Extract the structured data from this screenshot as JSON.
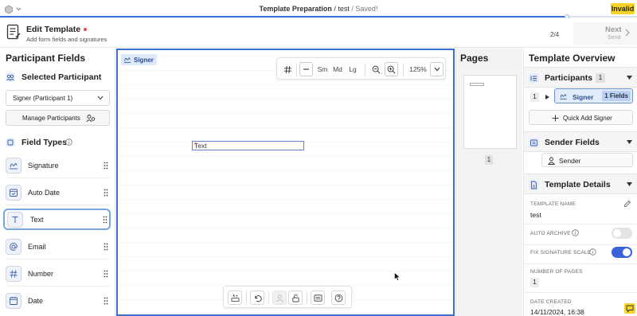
{
  "topbar": {
    "doc_name": "Template Preparation",
    "separator": " / ",
    "template": "test",
    "status": " / Saved!",
    "badge": "Invalid",
    "progress_fraction": 0.89,
    "badge_color": "#f5d328"
  },
  "header": {
    "title": "Edit Template",
    "subtitle": "Add form fields and signatures",
    "step": "2/4",
    "next_label": "Next",
    "next_sub": "Send"
  },
  "left": {
    "title": "Participant Fields",
    "selected_title": "Selected Participant",
    "selected_value": "Signer (Participant 1)",
    "manage_label": "Manage Participants",
    "field_types_title": "Field Types",
    "fields": [
      {
        "label": "Signature",
        "icon": "signature-icon"
      },
      {
        "label": "Auto Date",
        "icon": "calendar-check-icon"
      },
      {
        "label": "Text",
        "icon": "text-icon"
      },
      {
        "label": "Email",
        "icon": "at-icon"
      },
      {
        "label": "Number",
        "icon": "hash-icon"
      },
      {
        "label": "Date",
        "icon": "calendar-icon"
      }
    ],
    "active_field": "Text"
  },
  "canvas": {
    "signer_tag": "Signer",
    "toolbar": {
      "sizes": [
        "Sm",
        "Md",
        "Lg"
      ],
      "zoom": "125%"
    },
    "text_field": {
      "label": "Text",
      "required_mark": "*"
    }
  },
  "pages": {
    "title": "Pages",
    "page_number": "1"
  },
  "overview": {
    "title": "Template Overview",
    "participants_label": "Participants",
    "participants_count": "1",
    "row_number": "1",
    "signer_name": "Signer",
    "signer_fields": "1 Fields",
    "quick_add": "Quick Add Signer",
    "sender_fields_label": "Sender Fields",
    "sender_name": "Sender",
    "details_label": "Template Details",
    "template_name_label": "TEMPLATE NAME",
    "template_name_value": "test",
    "auto_archive_label": "AUTO ARCHIVE",
    "auto_archive_on": false,
    "fix_sig_label": "FIX SIGNATURE SCALE",
    "fix_sig_on": true,
    "num_pages_label": "NUMBER OF PAGES",
    "num_pages_value": "1",
    "date_created_label": "DATE CREATED",
    "date_created_value": "14/11/2024, 16:38"
  },
  "colors": {
    "accent": "#3a6fd8",
    "toggle_on": "#3b63d9",
    "toggle_off": "#e3e3e3",
    "required": "#e5484d"
  }
}
